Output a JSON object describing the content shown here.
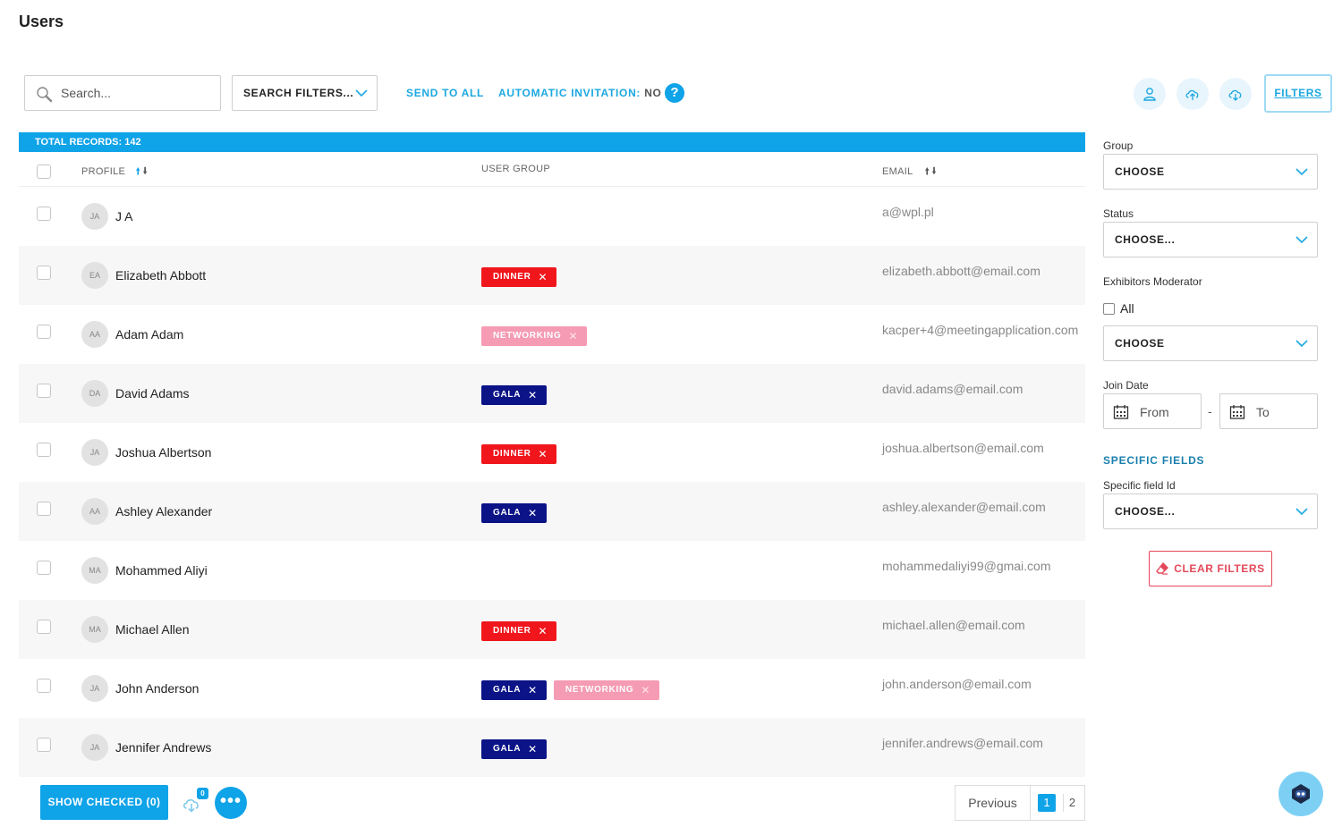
{
  "page": {
    "title": "Users"
  },
  "toolbar": {
    "search_placeholder": "Search...",
    "search_filters_label": "SEARCH FILTERS...",
    "send_to_all_label": "SEND TO ALL",
    "auto_invitation_label": "AUTOMATIC INVITATION:",
    "auto_invitation_value": "NO",
    "help_label": "?",
    "filters_label": "FILTERS",
    "icons": [
      "user-icon",
      "cloud-upload-icon",
      "cloud-download-icon"
    ]
  },
  "table": {
    "total_records": "TOTAL RECORDS: 142",
    "columns": {
      "profile": "PROFILE",
      "user_group": "USER GROUP",
      "email": "EMAIL"
    },
    "rows": [
      {
        "initials": "JA",
        "name": "J A",
        "tags": [],
        "email": "a@wpl.pl"
      },
      {
        "initials": "EA",
        "name": "Elizabeth Abbott",
        "tags": [
          "DINNER"
        ],
        "email": "elizabeth.abbott@email.com"
      },
      {
        "initials": "AA",
        "name": "Adam Adam",
        "tags": [
          "NETWORKING"
        ],
        "email": "kacper+4@meetingapplication.com"
      },
      {
        "initials": "DA",
        "name": "David Adams",
        "tags": [
          "GALA"
        ],
        "email": "david.adams@email.com"
      },
      {
        "initials": "JA",
        "name": "Joshua Albertson",
        "tags": [
          "DINNER"
        ],
        "email": "joshua.albertson@email.com"
      },
      {
        "initials": "AA",
        "name": "Ashley Alexander",
        "tags": [
          "GALA"
        ],
        "email": "ashley.alexander@email.com"
      },
      {
        "initials": "MA",
        "name": "Mohammed Aliyi",
        "tags": [],
        "email": "mohammedaliyi99@gmai.com"
      },
      {
        "initials": "MA",
        "name": "Michael Allen",
        "tags": [
          "DINNER"
        ],
        "email": "michael.allen@email.com"
      },
      {
        "initials": "JA",
        "name": "John Anderson",
        "tags": [
          "GALA",
          "NETWORKING"
        ],
        "email": "john.anderson@email.com"
      },
      {
        "initials": "JA",
        "name": "Jennifer Andrews",
        "tags": [
          "GALA"
        ],
        "email": "jennifer.andrews@email.com"
      }
    ]
  },
  "tag_colors": {
    "DINNER": "#f0161c",
    "NETWORKING": "#f59bb4",
    "GALA": "#0b1387"
  },
  "footer": {
    "show_checked_label": "SHOW CHECKED (0)",
    "download_badge": "0",
    "more_label": "•••",
    "pagination": {
      "previous_label": "Previous",
      "pages": [
        "1",
        "2"
      ],
      "active_page": "1"
    }
  },
  "sidebar": {
    "group_label": "Group",
    "group_value": "CHOOSE",
    "status_label": "Status",
    "status_value": "CHOOSE...",
    "exhibitors_label": "Exhibitors Moderator",
    "exhibitors_all_label": "All",
    "exhibitors_value": "CHOOSE",
    "join_date_label": "Join Date",
    "join_from_label": "From",
    "join_dash": "-",
    "join_to_label": "To",
    "specific_fields_title": "SPECIFIC FIELDS",
    "specific_field_label": "Specific field Id",
    "specific_field_value": "CHOOSE...",
    "clear_filters_label": "CLEAR FILTERS"
  },
  "colors": {
    "accent": "#0fa3e8",
    "danger": "#e5485a"
  }
}
